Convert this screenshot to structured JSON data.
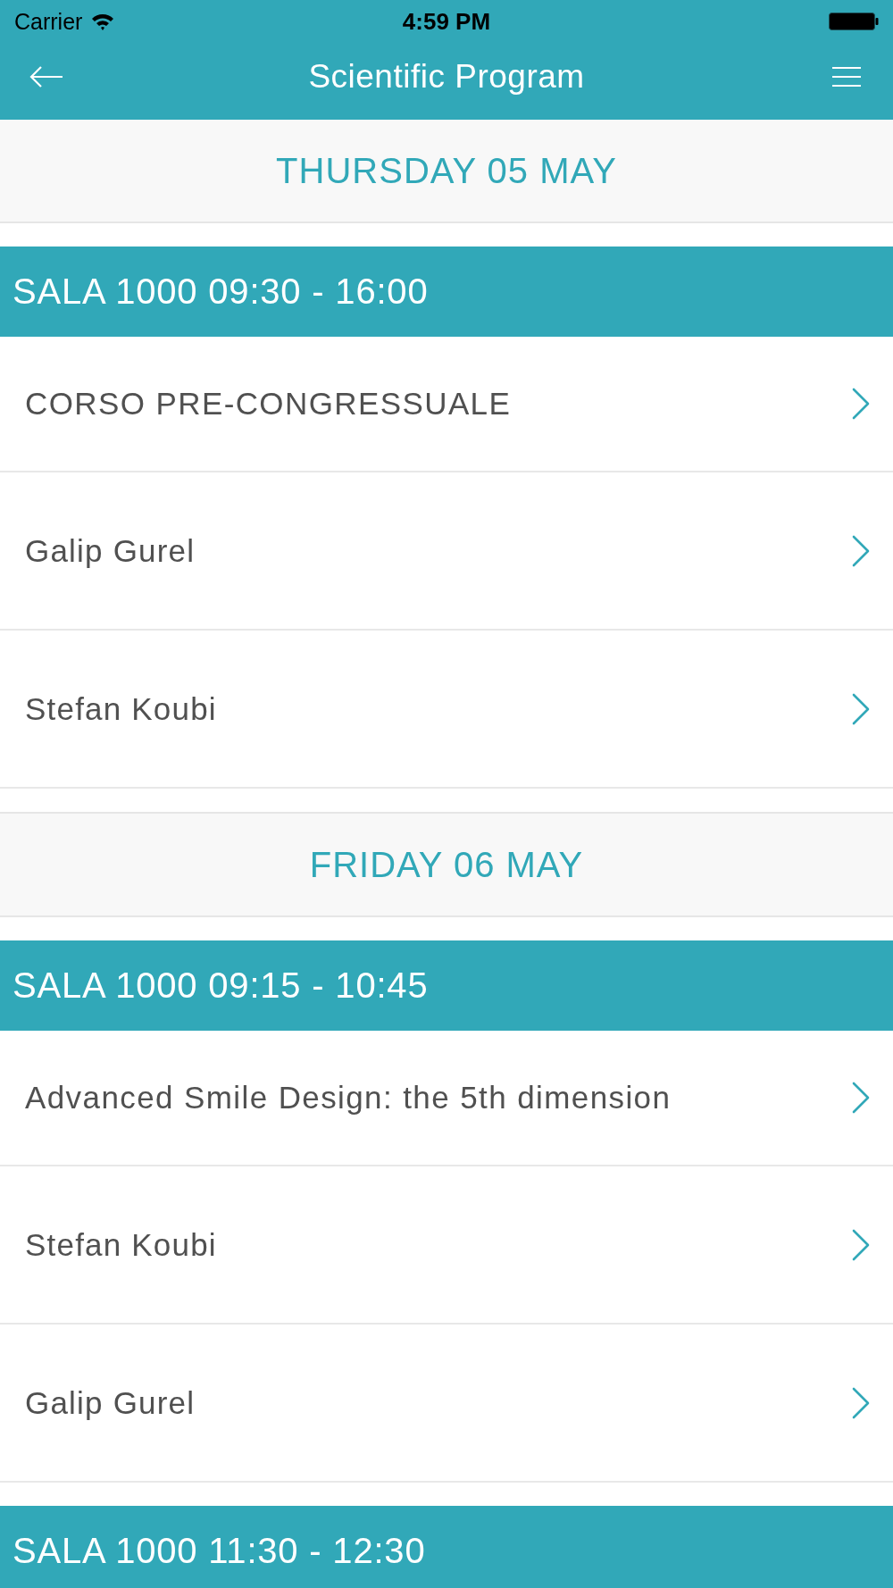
{
  "status_bar": {
    "carrier": "Carrier",
    "time": "4:59 PM"
  },
  "nav_bar": {
    "title": "Scientific Program"
  },
  "days": [
    {
      "label": "THURSDAY 05 MAY",
      "sessions": [
        {
          "label": "SALA 1000 09:30 - 16:00",
          "items": [
            {
              "kind": "title",
              "text": "CORSO PRE-CONGRESSUALE"
            },
            {
              "kind": "speaker",
              "text": "Galip Gurel"
            },
            {
              "kind": "speaker",
              "text": "Stefan Koubi"
            }
          ]
        }
      ]
    },
    {
      "label": "FRIDAY 06 MAY",
      "sessions": [
        {
          "label": "SALA 1000 09:15 - 10:45",
          "items": [
            {
              "kind": "title",
              "text": "Advanced Smile Design: the 5th dimension"
            },
            {
              "kind": "speaker",
              "text": "Stefan Koubi"
            },
            {
              "kind": "speaker",
              "text": "Galip Gurel"
            }
          ]
        },
        {
          "label": "SALA 1000 11:30 - 12:30"
        }
      ]
    }
  ]
}
